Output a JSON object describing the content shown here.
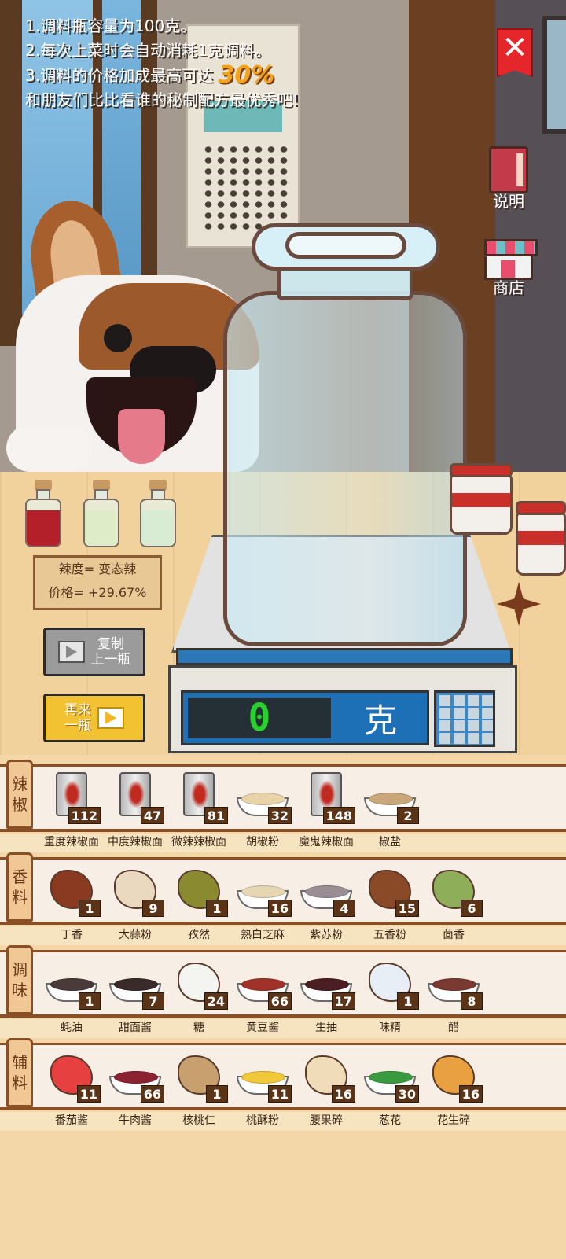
{
  "rules": {
    "line1": "1.调料瓶容量为100克。",
    "line2": "2.每次上菜时会自动消耗1克调料。",
    "line3_prefix": "3.调料的价格加成最高可达",
    "line3_pct": "30%",
    "line4": "和朋友们比比看谁的秘制配方最优秀吧!"
  },
  "side_buttons": {
    "help": "说明",
    "shop": "商店"
  },
  "info_sign": {
    "spicy": "辣度= 变态辣",
    "price": "价格= +29.67%"
  },
  "buttons": {
    "copy_line1": "复制",
    "copy_line2": "上一瓶",
    "again_line1": "再来",
    "again_line2": "一瓶"
  },
  "scale": {
    "weight": "0",
    "unit": "克"
  },
  "colors": {
    "accent_orange": "#f2a31a",
    "weight_green": "#28d12b",
    "close_red": "#e5262a"
  },
  "shelves": [
    {
      "tag": [
        "辣",
        "椒"
      ],
      "items": [
        {
          "name": "重度辣椒面",
          "count": "112",
          "icon": "can"
        },
        {
          "name": "中度辣椒面",
          "count": "47",
          "icon": "can"
        },
        {
          "name": "微辣辣椒面",
          "count": "81",
          "icon": "can"
        },
        {
          "name": "胡椒粉",
          "count": "32",
          "icon": "dish",
          "color": "#e8d3a8"
        },
        {
          "name": "魔鬼辣椒面",
          "count": "148",
          "icon": "can"
        },
        {
          "name": "椒盐",
          "count": "2",
          "icon": "dish",
          "color": "#c9a77a"
        }
      ]
    },
    {
      "tag": [
        "香",
        "料"
      ],
      "items": [
        {
          "name": "丁香",
          "count": "1",
          "icon": "blob",
          "color": "#8a3a20"
        },
        {
          "name": "大蒜粉",
          "count": "9",
          "icon": "blob",
          "color": "#ead9bf"
        },
        {
          "name": "孜然",
          "count": "1",
          "icon": "blob",
          "color": "#8a8a30"
        },
        {
          "name": "熟白芝麻",
          "count": "16",
          "icon": "dish",
          "color": "#e6d6b4"
        },
        {
          "name": "紫苏粉",
          "count": "4",
          "icon": "dish",
          "color": "#9a8e94"
        },
        {
          "name": "五香粉",
          "count": "15",
          "icon": "blob",
          "color": "#8a4a28"
        },
        {
          "name": "茴香",
          "count": "6",
          "icon": "blob",
          "color": "#8fae5a"
        }
      ]
    },
    {
      "tag": [
        "调",
        "味"
      ],
      "items": [
        {
          "name": "蚝油",
          "count": "1",
          "icon": "dish",
          "color": "#4a3a3a"
        },
        {
          "name": "甜面酱",
          "count": "7",
          "icon": "dish",
          "color": "#3a2a2a"
        },
        {
          "name": "糖",
          "count": "24",
          "icon": "blob",
          "color": "#f4f4f0"
        },
        {
          "name": "黄豆酱",
          "count": "66",
          "icon": "dish",
          "color": "#a0322a"
        },
        {
          "name": "生抽",
          "count": "17",
          "icon": "dish",
          "color": "#4a1e22"
        },
        {
          "name": "味精",
          "count": "1",
          "icon": "blob",
          "color": "#e8eef6"
        },
        {
          "name": "醋",
          "count": "8",
          "icon": "dish",
          "color": "#7a3a32"
        }
      ]
    },
    {
      "tag": [
        "辅",
        "料"
      ],
      "items": [
        {
          "name": "番茄酱",
          "count": "11",
          "icon": "blob",
          "color": "#e74040"
        },
        {
          "name": "牛肉酱",
          "count": "66",
          "icon": "dish",
          "color": "#8a2230"
        },
        {
          "name": "核桃仁",
          "count": "1",
          "icon": "blob",
          "color": "#c8a070"
        },
        {
          "name": "桃酥粉",
          "count": "11",
          "icon": "dish",
          "color": "#f0c83a"
        },
        {
          "name": "腰果碎",
          "count": "16",
          "icon": "blob",
          "color": "#f0dcb8"
        },
        {
          "name": "葱花",
          "count": "30",
          "icon": "dish",
          "color": "#3a9a40"
        },
        {
          "name": "花生碎",
          "count": "16",
          "icon": "blob",
          "color": "#e8a040"
        }
      ]
    }
  ]
}
